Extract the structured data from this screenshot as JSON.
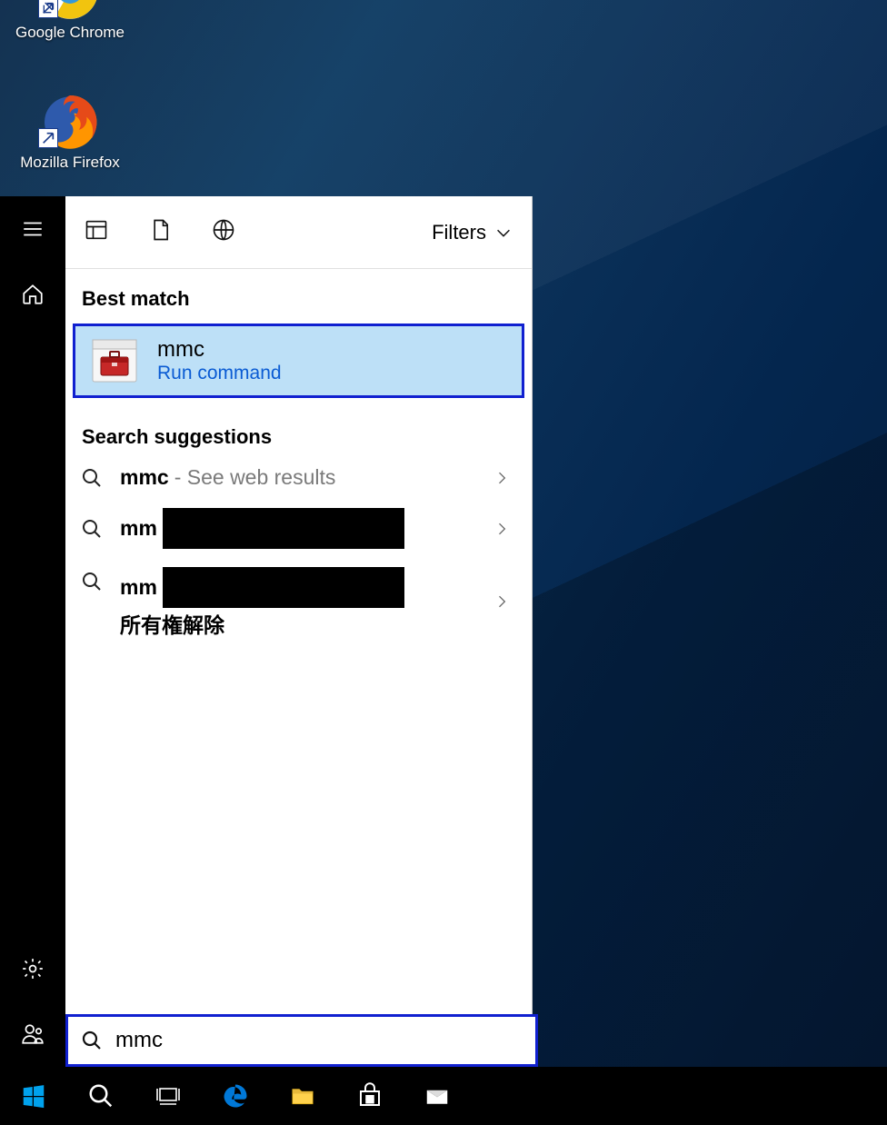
{
  "desktop": {
    "icons": [
      {
        "label": "Google Chrome"
      },
      {
        "label": "Mozilla Firefox"
      }
    ]
  },
  "left_rail": {
    "items_top": [
      "menu",
      "home"
    ],
    "items_bottom": [
      "settings",
      "user"
    ]
  },
  "search_panel": {
    "tabs": [
      "apps",
      "documents",
      "web"
    ],
    "filters_label": "Filters",
    "best_match_header": "Best match",
    "best_match": {
      "title": "mmc",
      "subtitle": "Run command"
    },
    "suggestions_header": "Search suggestions",
    "suggestions": [
      {
        "bold": "mmc",
        "light": " - See web results",
        "redacted": false,
        "tail": ""
      },
      {
        "bold": "mm",
        "light": "",
        "redacted": true,
        "tail": ""
      },
      {
        "bold": "mm",
        "light": "",
        "redacted": true,
        "tail": " 所有権解除"
      }
    ]
  },
  "search_input": {
    "value": "mmc"
  },
  "taskbar": {
    "items": [
      "start",
      "search",
      "task-view",
      "edge",
      "file-explorer",
      "store",
      "mail"
    ]
  }
}
